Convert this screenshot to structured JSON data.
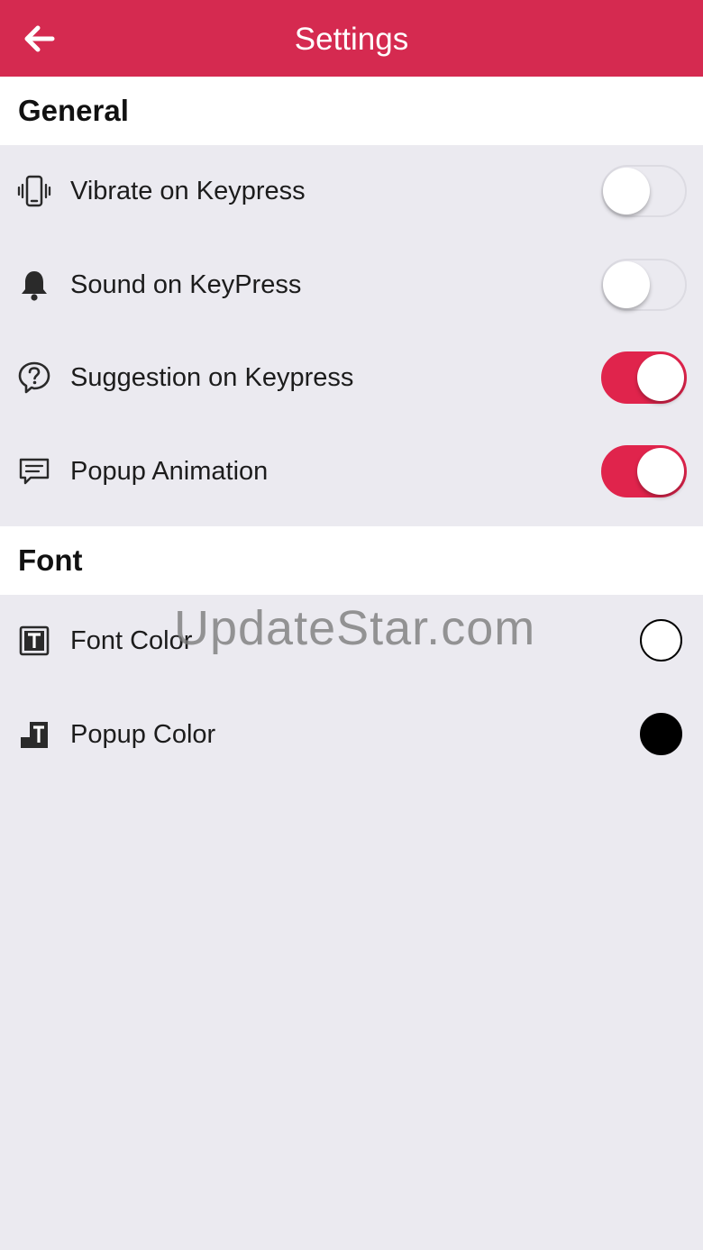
{
  "header": {
    "title": "Settings",
    "back_icon": "arrow-left-icon",
    "background_color": "#d52a50"
  },
  "sections": {
    "general": {
      "title": "General",
      "items": [
        {
          "label": "Vibrate on Keypress",
          "icon": "vibrate-phone-icon",
          "enabled": false
        },
        {
          "label": "Sound on KeyPress",
          "icon": "bell-icon",
          "enabled": false
        },
        {
          "label": "Suggestion on Keypress",
          "icon": "question-bubble-icon",
          "enabled": true
        },
        {
          "label": "Popup Animation",
          "icon": "message-icon",
          "enabled": true
        }
      ]
    },
    "font": {
      "title": "Font",
      "items": [
        {
          "label": "Font Color",
          "icon": "text-box-icon",
          "color": "#ffffff"
        },
        {
          "label": "Popup Color",
          "icon": "popup-text-icon",
          "color": "#000000"
        }
      ]
    }
  },
  "watermark": {
    "text": "UpdateStar.com"
  },
  "colors": {
    "accent": "#e0244c",
    "background": "#ebeaf0",
    "section_header_bg": "#ffffff"
  }
}
